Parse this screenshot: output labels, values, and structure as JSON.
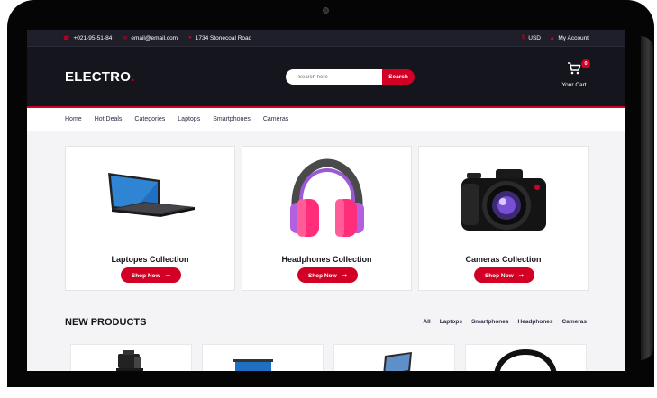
{
  "topbar": {
    "phone": "+021-95-51-84",
    "email": "email@email.com",
    "address": "1734 Stonecoal Road",
    "currency": "USD",
    "account": "My Account"
  },
  "header": {
    "logo": "ELECTRO",
    "logo_dot": ".",
    "search_placeholder": "Search here",
    "search_button": "Search",
    "cart_count": "0",
    "cart_label": "Your Cart"
  },
  "nav": {
    "items": [
      "Home",
      "Hot Deals",
      "Categories",
      "Laptops",
      "Smartphones",
      "Cameras"
    ]
  },
  "collections": [
    {
      "title": "Laptopes Collection",
      "button": "Shop Now",
      "icon": "laptop-icon"
    },
    {
      "title": "Headphones Collection",
      "button": "Shop Now",
      "icon": "headphones-icon"
    },
    {
      "title": "Cameras Collection",
      "button": "Shop Now",
      "icon": "camera-icon"
    }
  ],
  "new_products": {
    "title": "NEW PRODUCTS",
    "tabs": [
      "All",
      "Laptops",
      "Smartphones",
      "Headphones",
      "Cameras"
    ]
  },
  "colors": {
    "accent": "#d10024",
    "header_bg": "#15161d",
    "topbar_bg": "#1e1f29"
  }
}
